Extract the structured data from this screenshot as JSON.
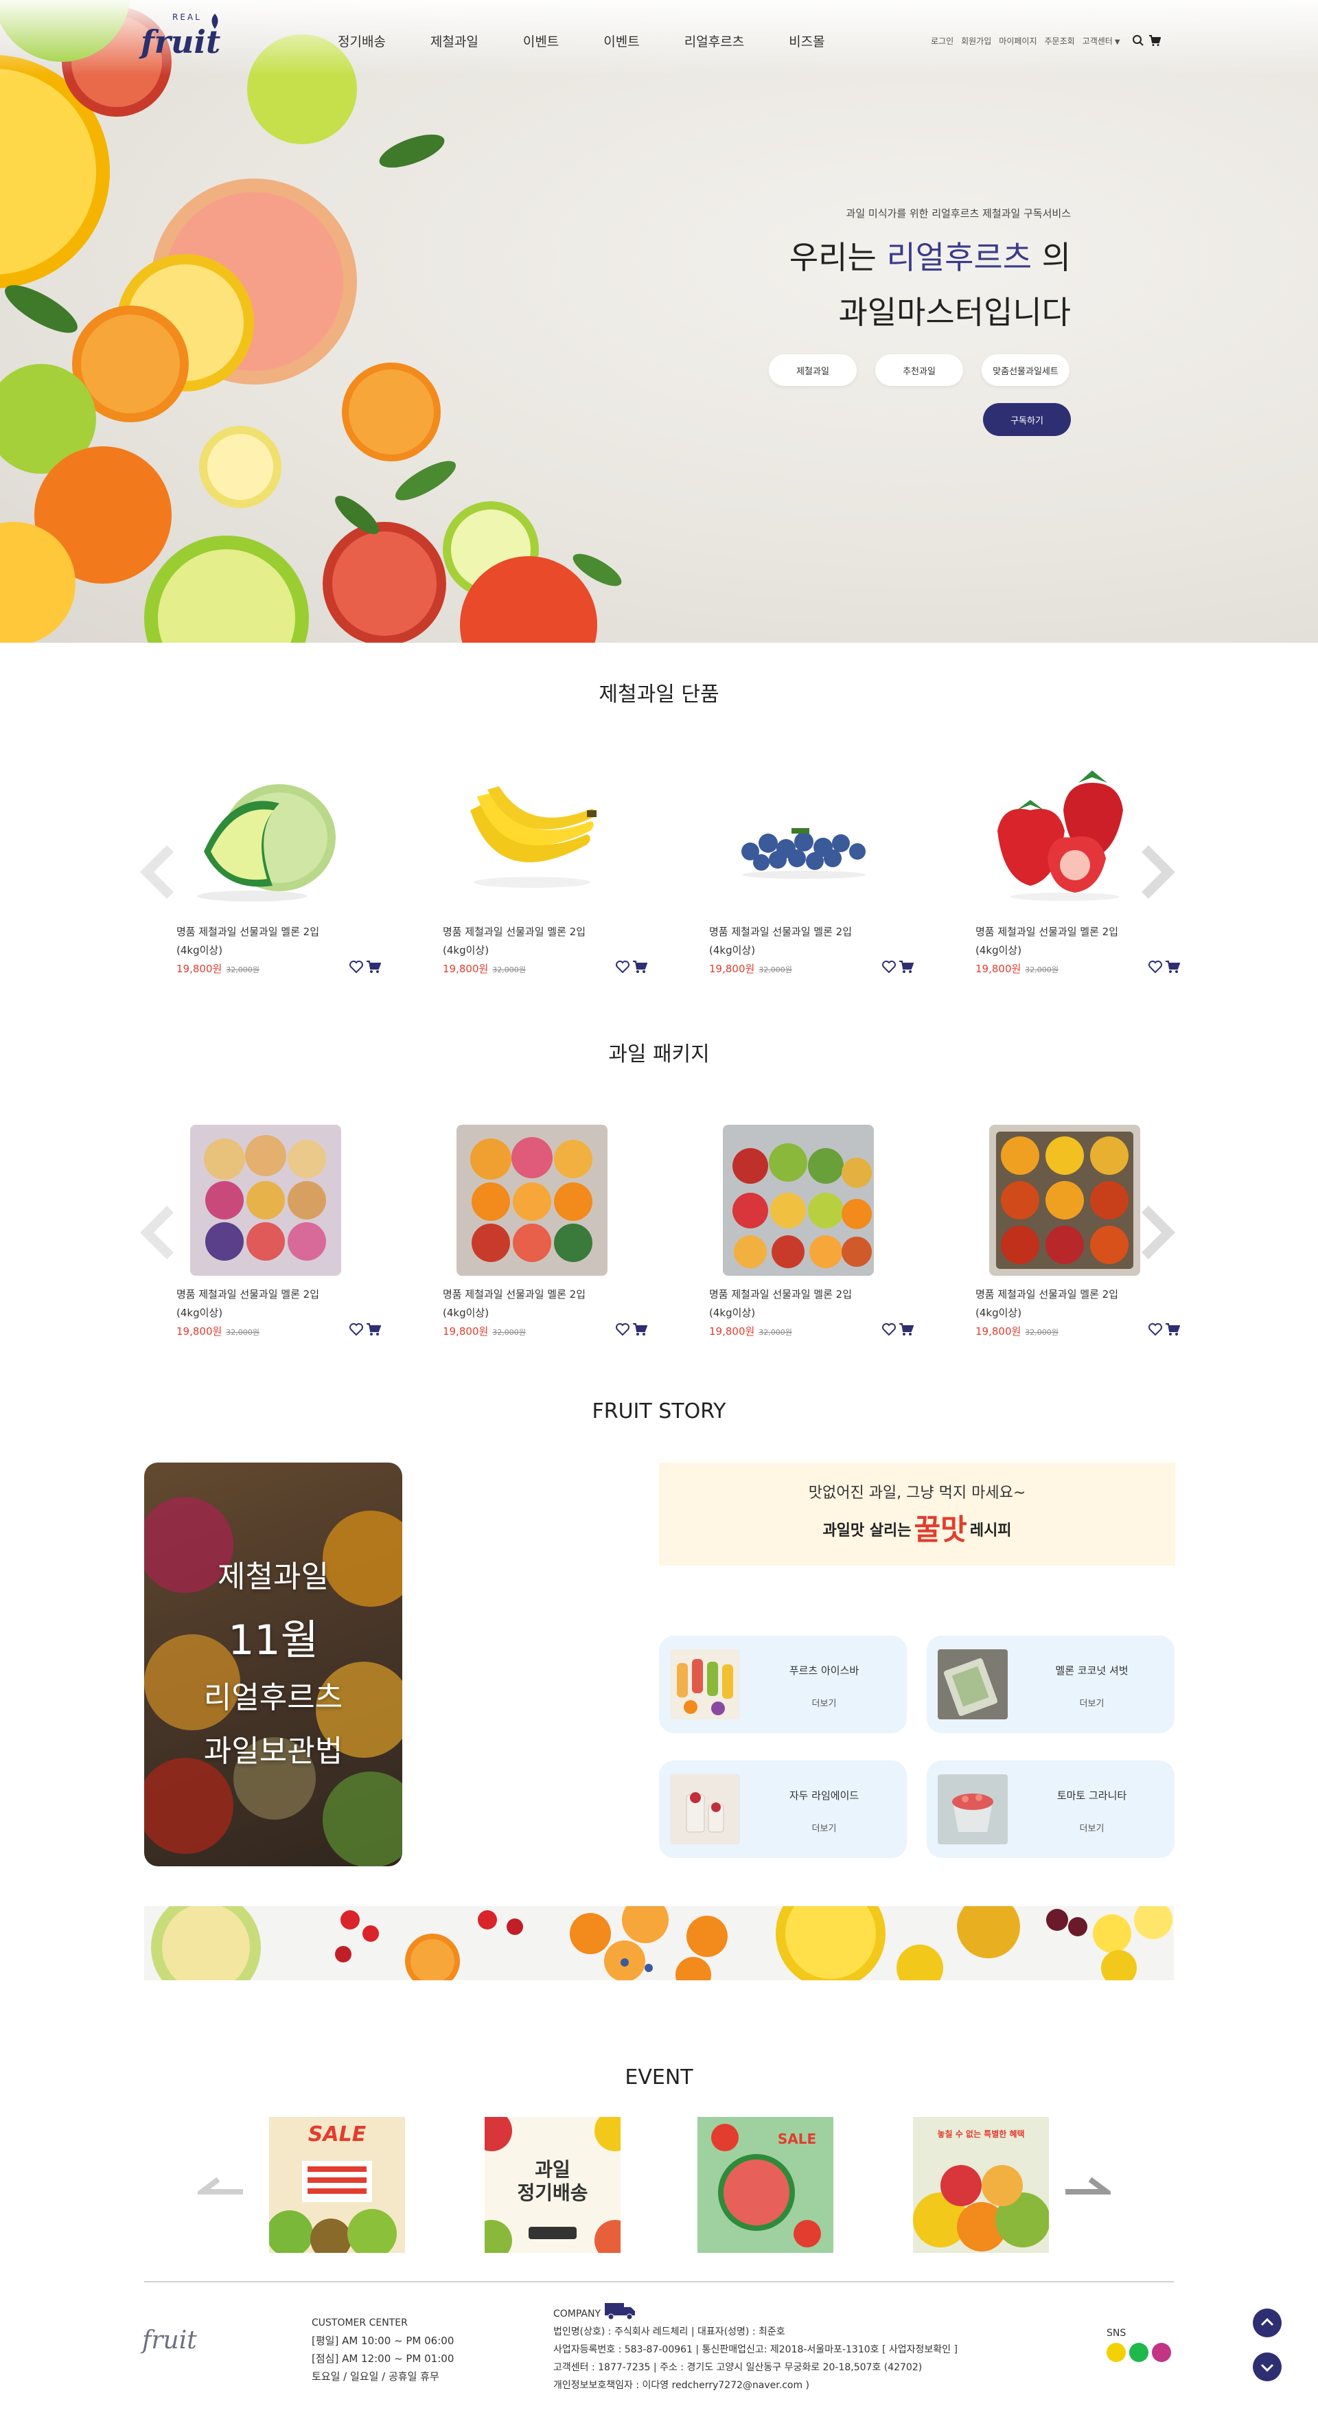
{
  "header": {
    "logo_sup": "REAL",
    "logo_text": "fruit",
    "nav": [
      "정기배송",
      "제철과일",
      "이벤트",
      "이벤트",
      "리얼후르츠",
      "비즈몰"
    ],
    "util": [
      "로그인",
      "회원가입",
      "마이페이지",
      "주문조회",
      "고객센터"
    ]
  },
  "hero": {
    "subtitle": "과일 미식가를 위한 리얼후르츠 제철과일 구독서비스",
    "title_line1_pre": "우리는 ",
    "title_line1_accent": "리얼후르츠",
    "title_line1_post": " 의",
    "title_line2": "과일마스터입니다",
    "chips": [
      "제철과일",
      "추천과일",
      "맞춤선물과일세트"
    ],
    "cta": "구독하기"
  },
  "sections": {
    "single": "제철과일 단품",
    "package": "과일 패키지",
    "story": "FRUIT STORY",
    "event": "EVENT"
  },
  "singles": [
    {
      "name": "명품 제철과일 선물과일 멜론 2입",
      "weight": "(4kg이상)",
      "price": "19,800원",
      "old_price": "32,000원",
      "icon": "melon"
    },
    {
      "name": "명품 제철과일 선물과일 멜론 2입",
      "weight": "(4kg이상)",
      "price": "19,800원",
      "old_price": "32,000원",
      "icon": "banana"
    },
    {
      "name": "명품 제철과일 선물과일 멜론 2입",
      "weight": "(4kg이상)",
      "price": "19,800원",
      "old_price": "32,000원",
      "icon": "blueberry"
    },
    {
      "name": "명품 제철과일 선물과일 멜론 2입",
      "weight": "(4kg이상)",
      "price": "19,800원",
      "old_price": "32,000원",
      "icon": "strawberry"
    }
  ],
  "packages": [
    {
      "name": "명품 제철과일 선물과일 멜론 2입",
      "weight": "(4kg이상)",
      "price": "19,800원",
      "old_price": "32,000원"
    },
    {
      "name": "명품 제철과일 선물과일 멜론 2입",
      "weight": "(4kg이상)",
      "price": "19,800원",
      "old_price": "32,000원"
    },
    {
      "name": "명품 제철과일 선물과일 멜론 2입",
      "weight": "(4kg이상)",
      "price": "19,800원",
      "old_price": "32,000원"
    },
    {
      "name": "명품 제철과일 선물과일 멜론 2입",
      "weight": "(4kg이상)",
      "price": "19,800원",
      "old_price": "32,000원"
    }
  ],
  "story": {
    "card_lines": [
      "제철과일",
      "11월",
      "리얼후르츠",
      "과일보관법"
    ],
    "recipe_line1": "맛없어진 과일, 그냥 먹지 마세요~",
    "recipe_line2_pre": "과일맛 살리는",
    "recipe_line2_big": "꿀맛",
    "recipe_line2_post": "레시피",
    "recipes": [
      {
        "title": "푸르츠 아이스바",
        "more": "더보기"
      },
      {
        "title": "멜론 코코넛 셔벗",
        "more": "더보기"
      },
      {
        "title": "자두 라임에이드",
        "more": "더보기"
      },
      {
        "title": "토마토 그라니타",
        "more": "더보기"
      }
    ]
  },
  "events": [
    {
      "label": "SALE"
    },
    {
      "label": "과일\n정기배송"
    },
    {
      "label": "SALE"
    },
    {
      "label": "놓칠 수 없는 특별한 혜택"
    }
  ],
  "footer": {
    "logo": "fruit",
    "cs_head": "CUSTOMER CENTER",
    "cs_lines": [
      "[평일] AM 10:00 ~ PM 06:00",
      "[점심] AM 12:00 ~ PM 01:00",
      "토요일 / 일요일 / 공휴일 휴무"
    ],
    "company_head": "COMPANY",
    "company_lines": [
      "법인명(상호) : 주식회사 레드체리  |  대표자(성명) : 최준호",
      "사업자등록번호 : 583-87-00961  |  통신판매업신고: 제2018-서울마포-1310호 [ 사업자정보확인 ]",
      "고객센터 : 1877-7235  |  주소 : 경기도 고양시 일산동구 무궁화로 20-18,507호 (42702)",
      "개인정보보호책임자 : 이다영 redcherry7272@naver.com )"
    ],
    "sns_label": "SNS"
  },
  "colors": {
    "brand": "#2e2f72",
    "price": "#e23d2f",
    "recipe_bg": "#eaf4fd",
    "banner_bg": "#fff6e3"
  }
}
